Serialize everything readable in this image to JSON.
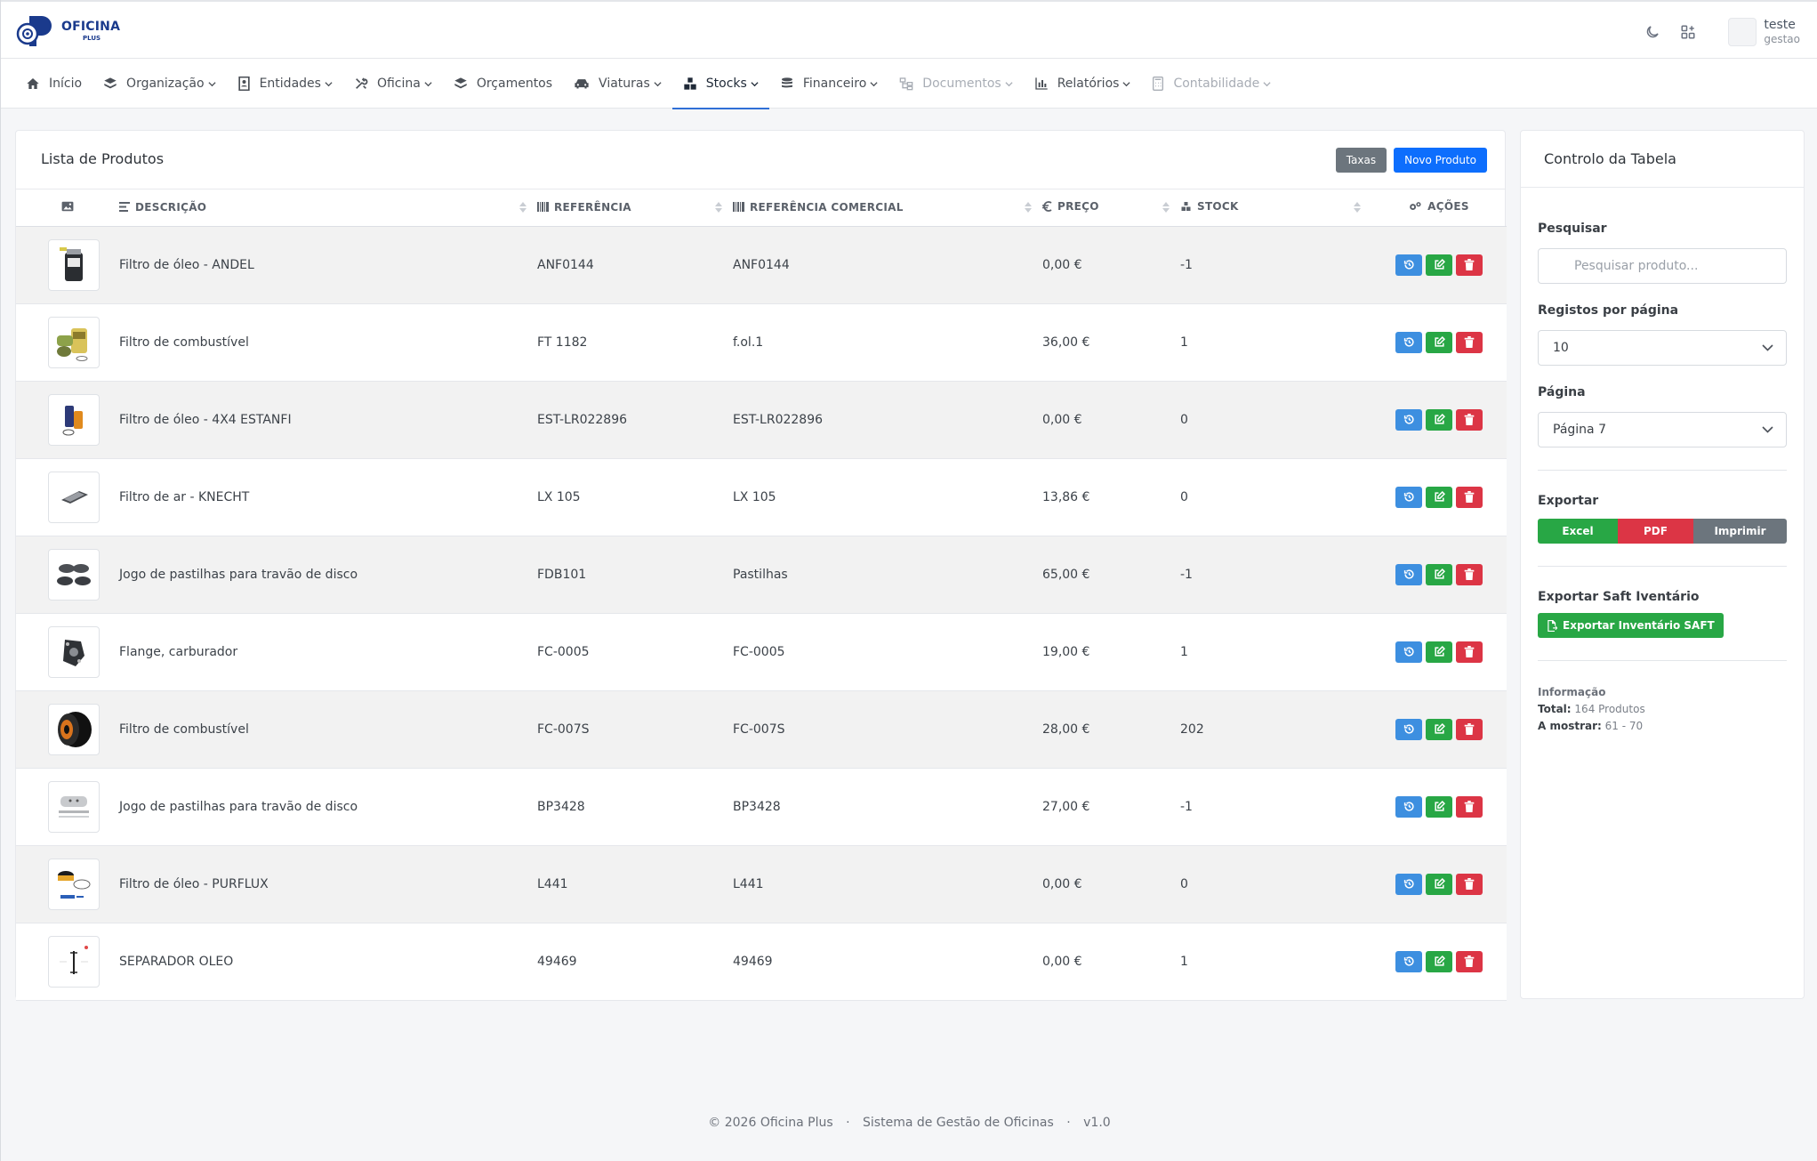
{
  "app": {
    "logo_line1": "OFICINA",
    "logo_line2": "PLUS",
    "user_name": "teste",
    "user_role": "gestao"
  },
  "nav": [
    {
      "label": "Início",
      "icon": "home-icon",
      "chevron": false,
      "state": "normal"
    },
    {
      "label": "Organização",
      "icon": "layers-icon",
      "chevron": true,
      "state": "normal"
    },
    {
      "label": "Entidades",
      "icon": "contacts-icon",
      "chevron": true,
      "state": "normal"
    },
    {
      "label": "Oficina",
      "icon": "tools-icon",
      "chevron": true,
      "state": "normal"
    },
    {
      "label": "Orçamentos",
      "icon": "stack-icon",
      "chevron": false,
      "state": "normal"
    },
    {
      "label": "Viaturas",
      "icon": "car-icon",
      "chevron": true,
      "state": "normal"
    },
    {
      "label": "Stocks",
      "icon": "boxes-icon",
      "chevron": true,
      "state": "active"
    },
    {
      "label": "Financeiro",
      "icon": "coins-icon",
      "chevron": true,
      "state": "normal"
    },
    {
      "label": "Documentos",
      "icon": "tree-icon",
      "chevron": true,
      "state": "disabled"
    },
    {
      "label": "Relatórios",
      "icon": "bar-chart-icon",
      "chevron": true,
      "state": "normal"
    },
    {
      "label": "Contabilidade",
      "icon": "calculator-icon",
      "chevron": true,
      "state": "disabled"
    }
  ],
  "list": {
    "title": "Lista de Produtos",
    "btn_taxas": "Taxas",
    "btn_novo": "Novo Produto",
    "columns": {
      "descricao": "Descrição",
      "referencia": "Referência",
      "ref_comercial": "Referência Comercial",
      "preco": "Preço",
      "stock": "Stock",
      "acoes": "Ações"
    },
    "rows": [
      {
        "desc": "Filtro de óleo - ANDEL",
        "ref": "ANF0144",
        "refc": "ANF0144",
        "preco": "0,00 €",
        "stock": "-1",
        "thumb": "oil-filter-thumb"
      },
      {
        "desc": "Filtro de combustível",
        "ref": "FT 1182",
        "refc": "f.ol.1",
        "preco": "36,00 €",
        "stock": "1",
        "thumb": "fuel-filter-thumb"
      },
      {
        "desc": "Filtro de óleo - 4X4 ESTANFI",
        "ref": "EST-LR022896",
        "refc": "EST-LR022896",
        "preco": "0,00 €",
        "stock": "0",
        "thumb": "oil-filter-cartridge-thumb"
      },
      {
        "desc": "Filtro de ar - KNECHT",
        "ref": "LX 105",
        "refc": "LX 105",
        "preco": "13,86 €",
        "stock": "0",
        "thumb": "air-filter-thumb"
      },
      {
        "desc": "Jogo de pastilhas para travão de disco",
        "ref": "FDB101",
        "refc": "Pastilhas",
        "preco": "65,00 €",
        "stock": "-1",
        "thumb": "brake-pads-thumb"
      },
      {
        "desc": "Flange, carburador",
        "ref": "FC-0005",
        "refc": "FC-0005",
        "preco": "19,00 €",
        "stock": "1",
        "thumb": "flange-thumb"
      },
      {
        "desc": "Filtro de combustível",
        "ref": "FC-007S",
        "refc": "FC-007S",
        "preco": "28,00 €",
        "stock": "202",
        "thumb": "fuel-filter-black-thumb"
      },
      {
        "desc": "Jogo de pastilhas para travão de disco",
        "ref": "BP3428",
        "refc": "BP3428",
        "preco": "27,00 €",
        "stock": "-1",
        "thumb": "brake-pads-grey-thumb"
      },
      {
        "desc": "Filtro de óleo - PURFLUX",
        "ref": "L441",
        "refc": "L441",
        "preco": "0,00 €",
        "stock": "0",
        "thumb": "oil-filter-purflux-thumb"
      },
      {
        "desc": "SEPARADOR OLEO",
        "ref": "49469",
        "refc": "49469",
        "preco": "0,00 €",
        "stock": "1",
        "thumb": "separator-thumb"
      }
    ]
  },
  "side": {
    "title": "Controlo da Tabela",
    "search_label": "Pesquisar",
    "search_placeholder": "Pesquisar produto...",
    "per_page_label": "Registos por página",
    "per_page_value": "10",
    "page_label": "Página",
    "page_value": "Página 7",
    "export_label": "Exportar",
    "export_excel": "Excel",
    "export_pdf": "PDF",
    "export_print": "Imprimir",
    "saft_label": "Exportar Saft Iventário",
    "saft_button": "Exportar Inventário SAFT",
    "info_title": "Informação",
    "total_label": "Total:",
    "total_value": "164 Produtos",
    "showing_label": "A mostrar:",
    "showing_value": "61 - 70"
  },
  "footer": {
    "copyright": "© 2026 Oficina Plus",
    "system": "Sistema de Gestão de Oficinas",
    "version": "v1.0"
  },
  "colors": {
    "primary": "#0d6efd",
    "success": "#28a745",
    "danger": "#dc3545",
    "secondary": "#6c757d",
    "history": "#3d8fe0",
    "active_tab": "#2f6fd6"
  }
}
